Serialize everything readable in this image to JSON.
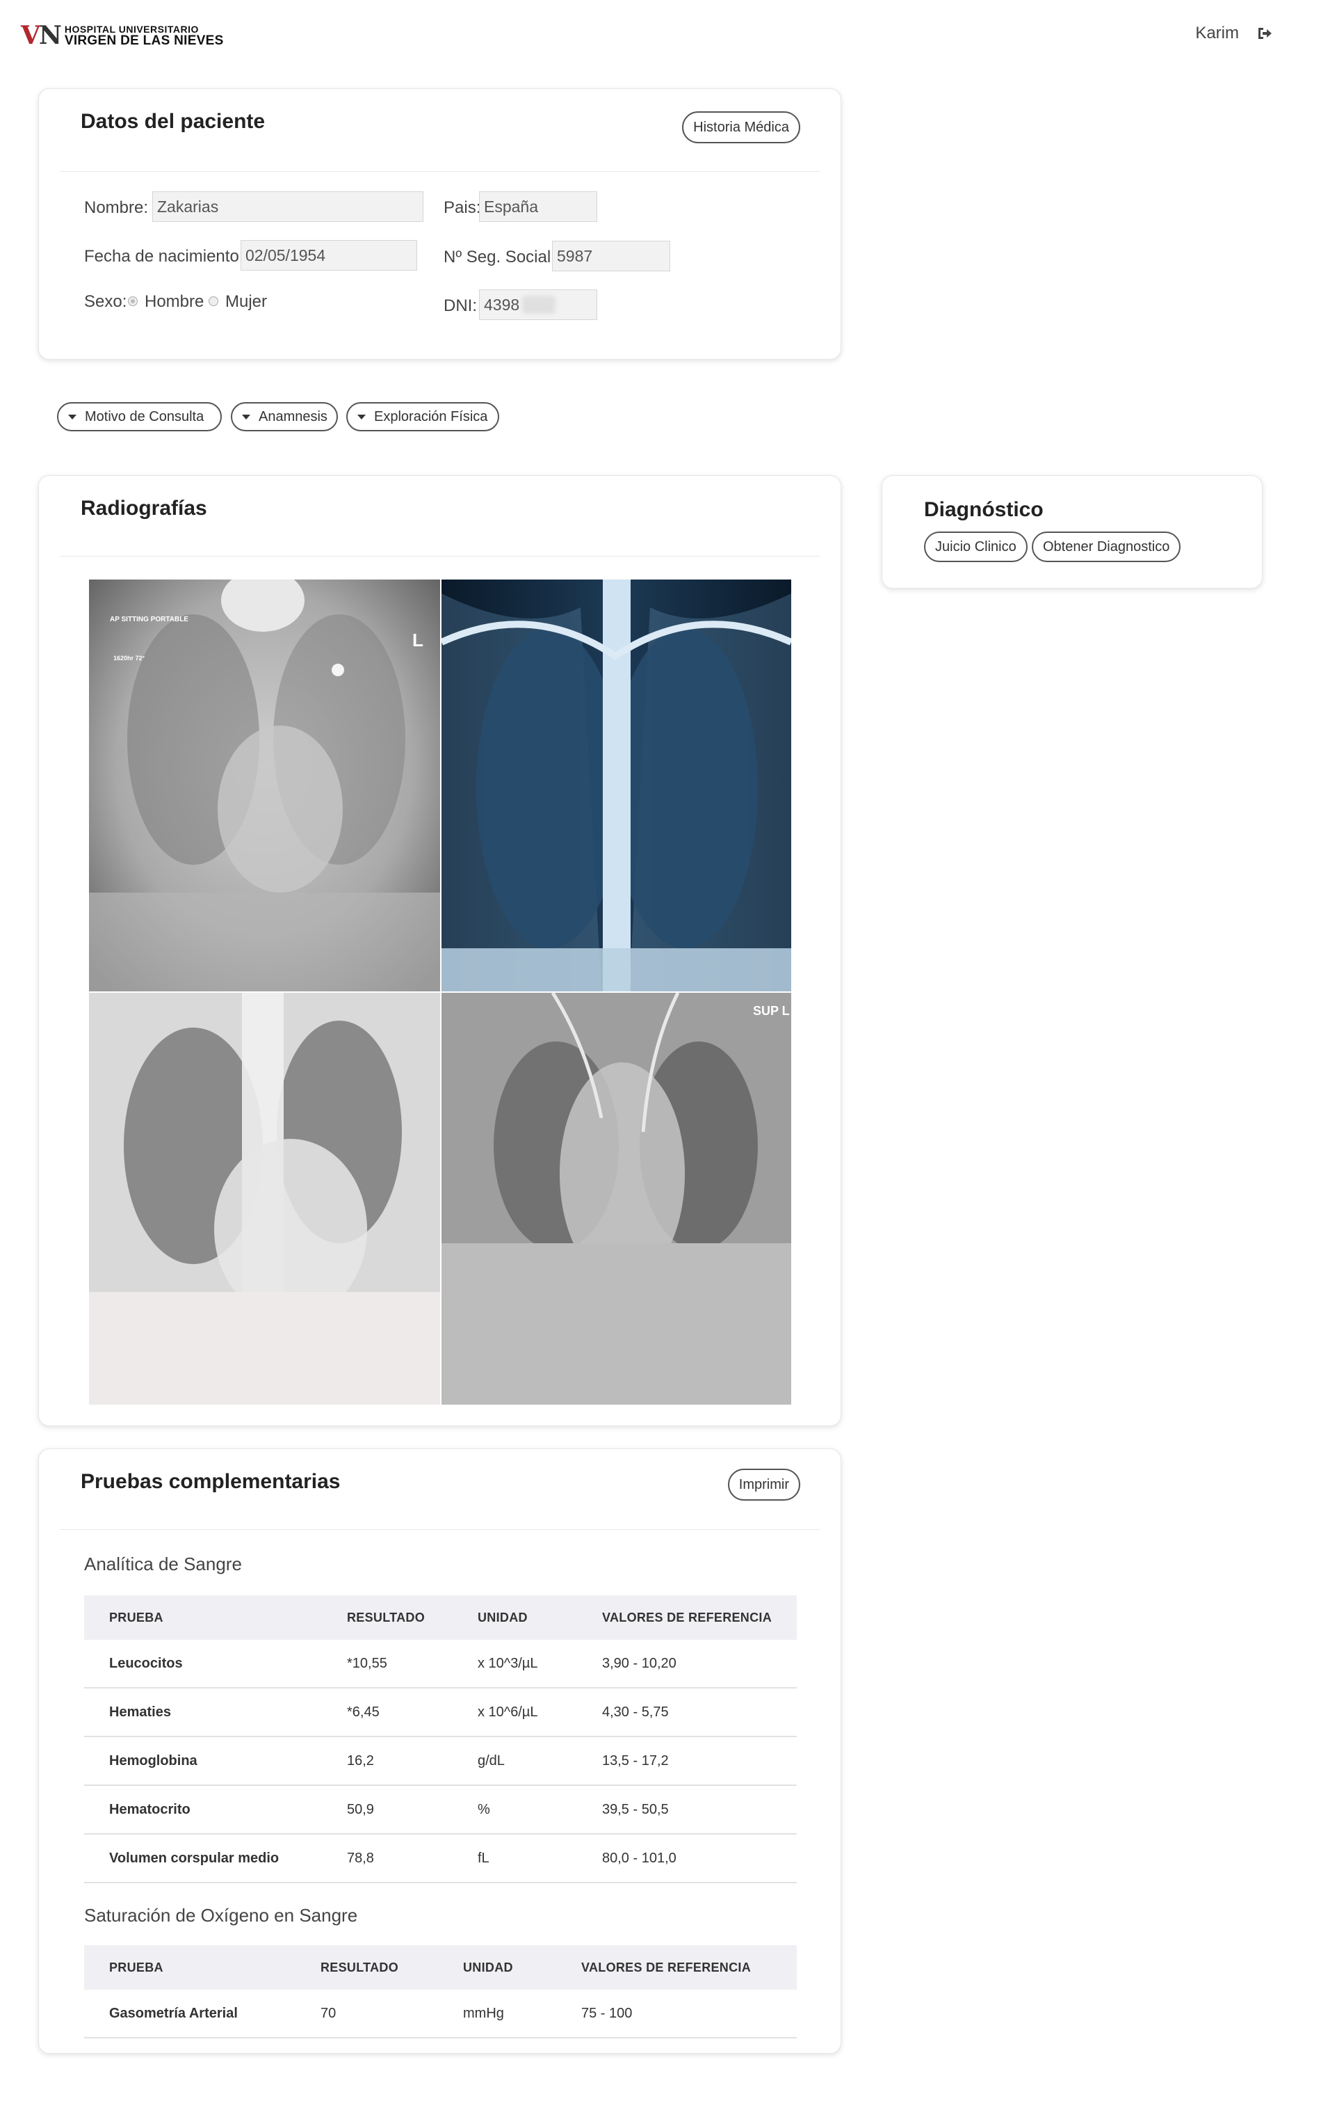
{
  "header": {
    "logo_mark": "VN",
    "logo_line1": "HOSPITAL UNIVERSITARIO",
    "logo_line2": "VIRGEN DE LAS NIEVES",
    "user_name": "Karim",
    "logout_icon": "logout-icon"
  },
  "patient": {
    "title": "Datos del paciente",
    "history_button": "Historia Médica",
    "nombre_label": "Nombre:",
    "nombre_value": "Zakarias",
    "fecha_label": "Fecha de nacimiento:",
    "fecha_value": "02/05/1954",
    "sexo_label": "Sexo:",
    "sexo_options": [
      "Hombre",
      "Mujer"
    ],
    "sexo_selected": "Hombre",
    "pais_label": "Pais:",
    "pais_value": "España",
    "seg_label": "Nº Seg. Social:",
    "seg_value": "5987",
    "dni_label": "DNI:",
    "dni_value": "4398"
  },
  "collapsibles": [
    "Motivo de Consulta",
    "Anamnesis",
    "Exploración Física"
  ],
  "radiografias": {
    "title": "Radiografías",
    "images": [
      {
        "name": "xray-ap-sitting-portable",
        "labels": [
          "AP SITTING PORTABLE",
          "1620hr 72°",
          "L"
        ]
      },
      {
        "name": "xray-pa-chest",
        "labels": []
      },
      {
        "name": "xray-chest-3",
        "labels": []
      },
      {
        "name": "xray-supine",
        "labels": [
          "SUP L"
        ]
      }
    ]
  },
  "diagnostico": {
    "title": "Diagnóstico",
    "buttons": [
      "Juicio Clinico",
      "Obtener Diagnostico"
    ]
  },
  "pruebas": {
    "title": "Pruebas complementarias",
    "print_button": "Imprimir",
    "sangre": {
      "title": "Analítica de Sangre",
      "headers": [
        "PRUEBA",
        "RESULTADO",
        "UNIDAD",
        "VALORES DE REFERENCIA"
      ],
      "rows": [
        [
          "Leucocitos",
          "*10,55",
          "x 10^3/µL",
          "3,90 - 10,20"
        ],
        [
          "Hematies",
          "*6,45",
          "x 10^6/µL",
          "4,30 - 5,75"
        ],
        [
          "Hemoglobina",
          "16,2",
          "g/dL",
          "13,5 - 17,2"
        ],
        [
          "Hematocrito",
          "50,9",
          "%",
          "39,5 - 50,5"
        ],
        [
          "Volumen corspular medio",
          "78,8",
          "fL",
          "80,0 - 101,0"
        ]
      ]
    },
    "oxigeno": {
      "title": "Saturación de Oxígeno en Sangre",
      "headers": [
        "PRUEBA",
        "RESULTADO",
        "UNIDAD",
        "VALORES DE REFERENCIA"
      ],
      "rows": [
        [
          "Gasometría Arterial",
          "70",
          "mmHg",
          "75 - 100"
        ]
      ]
    }
  }
}
